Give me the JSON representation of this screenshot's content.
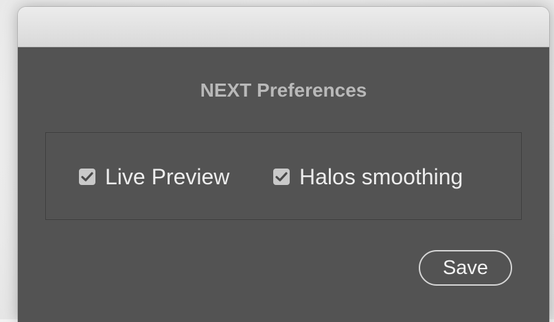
{
  "dialog": {
    "title": "NEXT Preferences"
  },
  "options": [
    {
      "label": "Live Preview",
      "checked": true
    },
    {
      "label": "Halos smoothing",
      "checked": true
    }
  ],
  "buttons": {
    "save_label": "Save"
  },
  "colors": {
    "panel_background": "#535353",
    "titlebar": "#e0e0e0",
    "title_text": "#b9b9b9",
    "label_text": "#ededed",
    "checkbox_fill": "#c9c9c9"
  },
  "icons": {
    "checkbox_mark": "checkmark-icon"
  }
}
